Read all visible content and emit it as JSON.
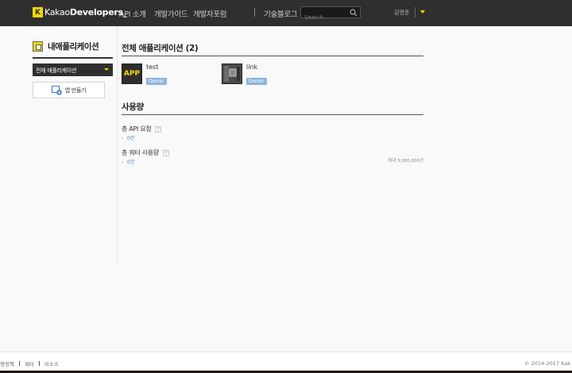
{
  "header": {
    "logo_mark": "K",
    "logo_prefix": "Kakao",
    "logo_bold": "Developers",
    "logo_cursor": "_",
    "nav": [
      "API 소개",
      "개발가이드",
      "개발자포럼"
    ],
    "blog": "기술블로그",
    "search_placeholder": "Search",
    "user_name": "김영준"
  },
  "sidebar": {
    "title": "내애플리케이션",
    "filter_selected": "전체 애플리케이션",
    "create_label": "앱 만들기"
  },
  "main": {
    "apps_title": "전체 애플리케이션 (2)",
    "apps": [
      {
        "thumb_text": "APP",
        "name": "test",
        "badge": "Owner"
      },
      {
        "thumb_text": "",
        "name": "link",
        "badge": "Owner"
      }
    ],
    "usage_title": "사용량",
    "usage": [
      {
        "label": "총 API 요청",
        "help": "?",
        "value": "0건"
      },
      {
        "label": "총 쿼터 사용량",
        "help": "?",
        "value": "0건",
        "max": "최대 3,000,000건"
      }
    ],
    "usage_dash": "-"
  },
  "footer": {
    "links": [
      "영정책",
      "워터",
      "리소스"
    ],
    "copyright": "© 2014-2017 Kak"
  },
  "colors": {
    "topbar": "#2f2f2f",
    "accent_yellow": "#f5d60a",
    "owner_badge": "#8fb4dc",
    "usage_blue": "#3a78c2"
  }
}
